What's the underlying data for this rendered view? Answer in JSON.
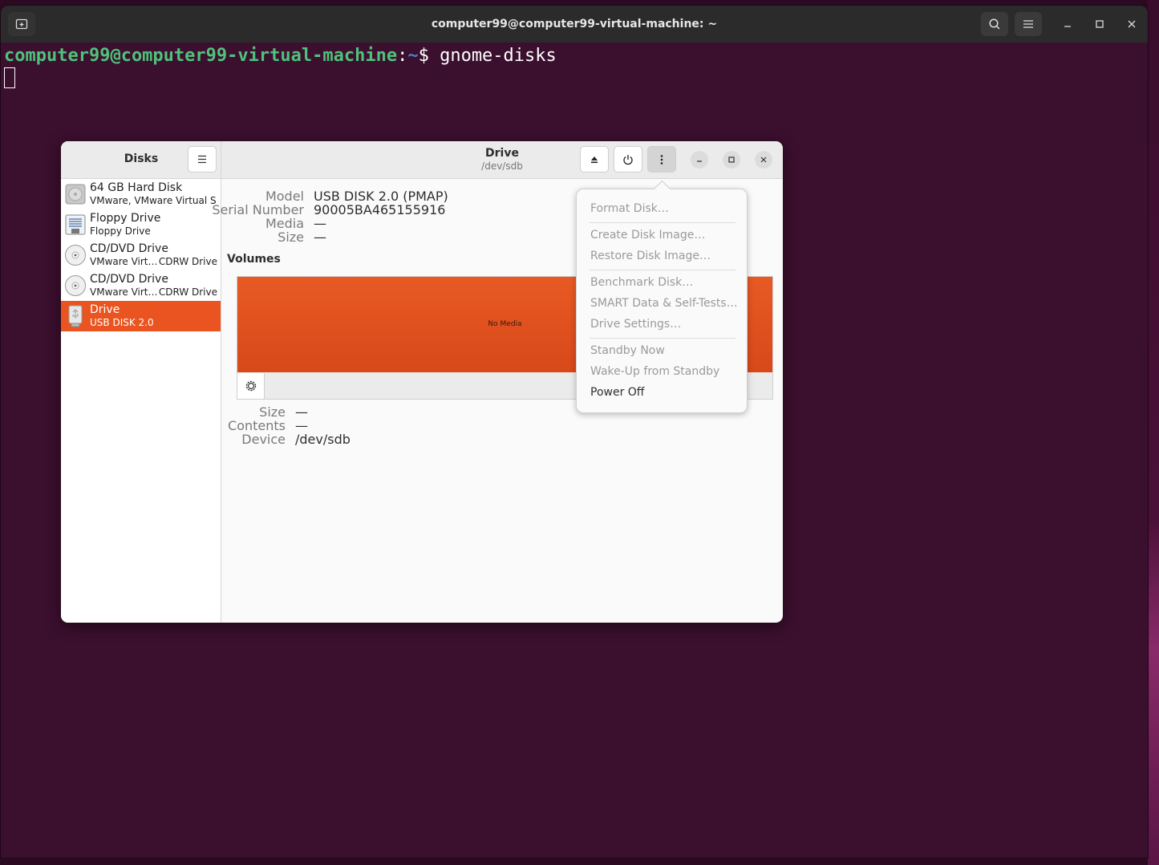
{
  "terminal": {
    "title": "computer99@computer99-virtual-machine: ~",
    "prompt_user": "computer99@computer99-virtual-machine",
    "prompt_sep": ":",
    "prompt_path": "~",
    "prompt_dollar": "$ ",
    "command": "gnome-disks",
    "new_tab_icon": "new-tab-icon",
    "search_icon": "search-icon",
    "menu_icon": "hamburger-icon"
  },
  "disks": {
    "sidebar_title": "Disks",
    "drives": [
      {
        "name": "64 GB Hard Disk",
        "sub": "VMware, VMware Virtual S",
        "sub2": "",
        "icon": "hard-disk-icon"
      },
      {
        "name": "Floppy Drive",
        "sub": "Floppy Drive",
        "sub2": "",
        "icon": "floppy-icon"
      },
      {
        "name": "CD/DVD Drive",
        "sub": "VMware Virt…",
        "sub2": "CDRW Drive",
        "icon": "cd-icon"
      },
      {
        "name": "CD/DVD Drive",
        "sub": "VMware Virt…",
        "sub2": "CDRW Drive",
        "icon": "cd-icon"
      },
      {
        "name": "Drive",
        "sub": "USB DISK 2.0",
        "sub2": "",
        "icon": "usb-icon"
      }
    ],
    "header_title": "Drive",
    "header_subtitle": "/dev/sdb",
    "info": {
      "model_label": "Model",
      "model_value": "USB DISK 2.0 (PMAP)",
      "serial_label": "Serial Number",
      "serial_value": "90005BA465155916",
      "media_label": "Media",
      "media_value": "—",
      "size_label": "Size",
      "size_value": "—"
    },
    "volumes_title": "Volumes",
    "volume_bar_label": "No Media",
    "volume_info": {
      "size_label": "Size",
      "size_value": "—",
      "contents_label": "Contents",
      "contents_value": "—",
      "device_label": "Device",
      "device_value": "/dev/sdb"
    },
    "menu": {
      "format_disk": "Format Disk…",
      "create_image": "Create Disk Image…",
      "restore_image": "Restore Disk Image…",
      "benchmark": "Benchmark Disk…",
      "smart": "SMART Data & Self-Tests…",
      "settings": "Drive Settings…",
      "standby": "Standby Now",
      "wakeup": "Wake-Up from Standby",
      "power_off": "Power Off"
    },
    "accent_color": "#e95420"
  }
}
